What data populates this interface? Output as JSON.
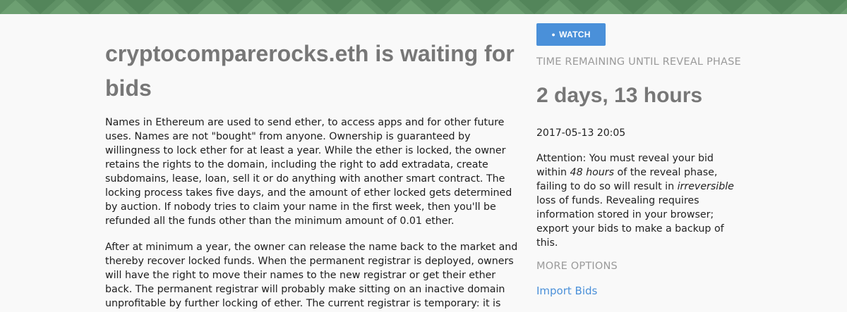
{
  "colors": {
    "banner": "#5f9165",
    "accent": "#4a90d9",
    "title": "#777777",
    "muted": "#9a9a9a"
  },
  "page": {
    "title": "cryptocomparerocks.eth is waiting for bids",
    "paragraph_1": "Names in Ethereum are used to send ether, to access apps and for other future uses. Names are not \"bought\" from anyone. Ownership is guaranteed by willingness to lock ether for at least a year. While the ether is locked, the owner retains the rights to the domain, including the right to add extradata, create subdomains, lease, loan, sell it or do anything with another smart contract. The locking process takes five days, and the amount of ether locked gets determined by auction. If nobody tries to claim your name in the first week, then you'll be refunded all the funds other than the minimum amount of 0.01 ether.",
    "paragraph_2": "After at minimum a year, the owner can release the name back to the market and thereby recover locked funds. When the permanent registrar is deployed, owners will have the right to move their names to the new registrar or get their ether back. The permanent registrar will probably make sitting on an inactive domain unprofitable by further locking of ether. The current registrar is temporary: it is"
  },
  "sidebar": {
    "watch_icon": "eye-icon",
    "watch_label": "WATCH",
    "time_remaining_label": "TIME REMAINING UNTIL REVEAL PHASE",
    "countdown": "2 days, 13 hours",
    "reveal_date": "2017-05-13 20:05",
    "attention_prefix": "Attention: You must reveal your bid within ",
    "attention_hours": "48 hours",
    "attention_middle": " of the reveal phase, failing to do so will result in ",
    "attention_irreversible": "irreversible",
    "attention_suffix": " loss of funds. Revealing requires information stored in your browser; export your bids to make a backup of this.",
    "more_options_label": "MORE OPTIONS",
    "import_bids_label": "Import Bids"
  }
}
